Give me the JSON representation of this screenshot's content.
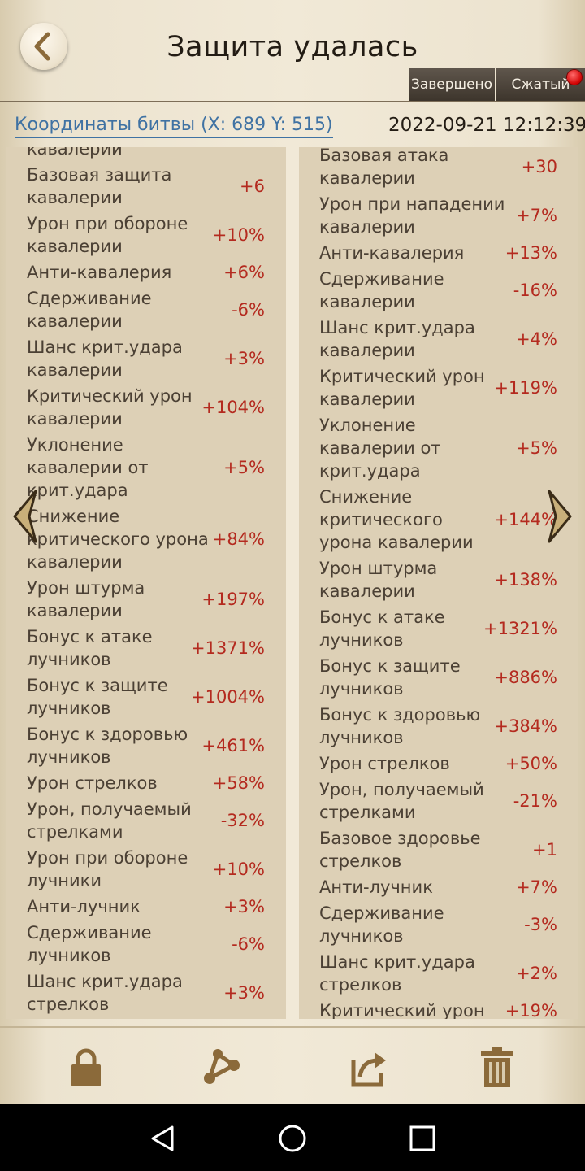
{
  "header": {
    "title": "Защита удалась",
    "done_label": "Завершено",
    "compact_label": "Сжатый"
  },
  "info": {
    "coords": "Координаты битвы (X: 689 Y: 515)",
    "datetime": "2022-09-21  12:12:39"
  },
  "left_stats": [
    {
      "label": "кавалерии",
      "value": ""
    },
    {
      "label": "Базовая защита кавалерии",
      "value": "+6"
    },
    {
      "label": "Урон при обороне кавалерии",
      "value": "+10%"
    },
    {
      "label": "Анти-кавалерия",
      "value": "+6%"
    },
    {
      "label": "Сдерживание кавалерии",
      "value": "-6%"
    },
    {
      "label": "Шанс крит.удара кавалерии",
      "value": "+3%"
    },
    {
      "label": "Критический урон кавалерии",
      "value": "+104%"
    },
    {
      "label": "Уклонение кавалерии от крит.удара",
      "value": "+5%"
    },
    {
      "label": "Снижение критического урона кавалерии",
      "value": "+84%"
    },
    {
      "label": "Урон штурма кавалерии",
      "value": "+197%"
    },
    {
      "label": "Бонус к атаке лучников",
      "value": "+1371%"
    },
    {
      "label": "Бонус к защите лучников",
      "value": "+1004%"
    },
    {
      "label": "Бонус к здоровью лучников",
      "value": "+461%"
    },
    {
      "label": "Урон стрелков",
      "value": "+58%"
    },
    {
      "label": "Урон, получаемый стрелками",
      "value": "-32%"
    },
    {
      "label": "Урон при обороне лучники",
      "value": "+10%"
    },
    {
      "label": "Анти-лучник",
      "value": "+3%"
    },
    {
      "label": "Сдерживание лучников",
      "value": "-6%"
    },
    {
      "label": "Шанс крит.удара стрелков",
      "value": "+3%"
    }
  ],
  "right_stats": [
    {
      "label": "Базовая атака кавалерии",
      "value": "+30"
    },
    {
      "label": "Урон при нападении кавалерии",
      "value": "+7%"
    },
    {
      "label": "Анти-кавалерия",
      "value": "+13%"
    },
    {
      "label": "Сдерживание кавалерии",
      "value": "-16%"
    },
    {
      "label": "Шанс крит.удара кавалерии",
      "value": "+4%"
    },
    {
      "label": "Критический урон кавалерии",
      "value": "+119%"
    },
    {
      "label": "Уклонение кавалерии от крит.удара",
      "value": "+5%"
    },
    {
      "label": "Снижение критического урона кавалерии",
      "value": "+144%"
    },
    {
      "label": "Урон штурма кавалерии",
      "value": "+138%"
    },
    {
      "label": "Бонус к атаке лучников",
      "value": "+1321%"
    },
    {
      "label": "Бонус к защите лучников",
      "value": "+886%"
    },
    {
      "label": "Бонус к здоровью лучников",
      "value": "+384%"
    },
    {
      "label": "Урон стрелков",
      "value": "+50%"
    },
    {
      "label": "Урон, получаемый стрелками",
      "value": "-21%"
    },
    {
      "label": "Базовое здоровье стрелков",
      "value": "+1"
    },
    {
      "label": "Анти-лучник",
      "value": "+7%"
    },
    {
      "label": "Сдерживание лучников",
      "value": "-3%"
    },
    {
      "label": "Шанс крит.удара стрелков",
      "value": "+2%"
    },
    {
      "label": "Критический урон",
      "value": "+19%"
    }
  ],
  "toolbar": {
    "icons": [
      "lock-icon",
      "share-icon",
      "export-icon",
      "trash-icon"
    ]
  },
  "colors": {
    "value_text": "#b42a1f",
    "link_text": "#3f72a3",
    "icon_brown": "#8b6a3a"
  }
}
